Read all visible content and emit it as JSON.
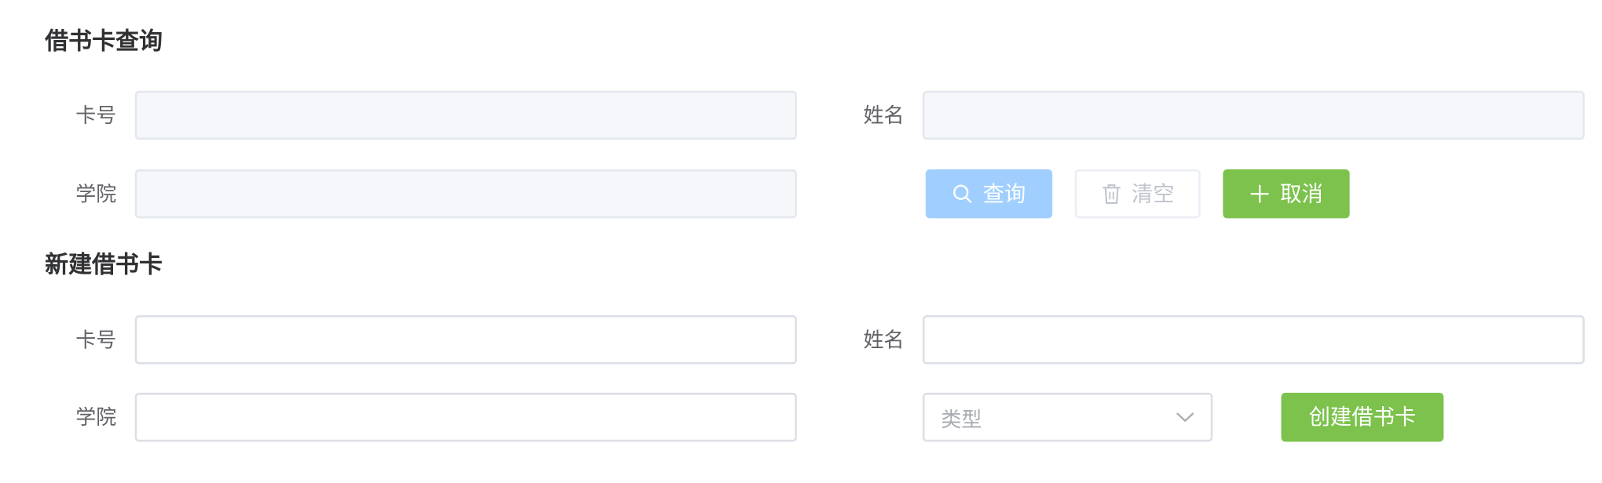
{
  "query_section": {
    "title": "借书卡查询",
    "card_label": "卡号",
    "name_label": "姓名",
    "college_label": "学院",
    "card_value": "",
    "name_value": "",
    "college_value": "",
    "query_button": "查询",
    "clear_button": "清空",
    "cancel_button": "取消"
  },
  "create_section": {
    "title": "新建借书卡",
    "card_label": "卡号",
    "name_label": "姓名",
    "college_label": "学院",
    "card_value": "",
    "name_value": "",
    "college_value": "",
    "type_placeholder": "类型",
    "create_button": "创建借书卡"
  },
  "icons": {
    "query": "search-icon",
    "clear": "trash-icon",
    "cancel": "plus-icon",
    "type_select": "chevron-down-icon"
  },
  "colors": {
    "title_text": "#303133",
    "label_text": "#606266",
    "disabled_input_bg": "#f5f7fa",
    "input_border": "#dcdfe6",
    "query_button": "#a0cfff",
    "success_button": "#7cc24d",
    "clear_text": "#c0c4cc"
  }
}
